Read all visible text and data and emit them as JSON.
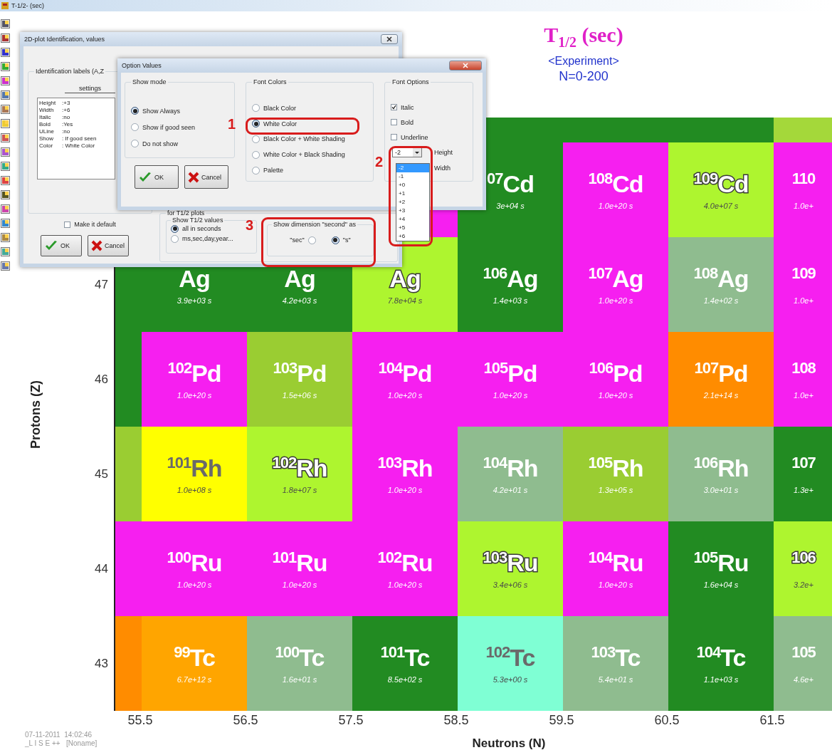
{
  "window": {
    "title": "T-1/2- (sec)"
  },
  "plot": {
    "title": "T$_{1/2}$ (sec)",
    "subtitle": "<Experiment>",
    "range": "N=0-200",
    "y_axis": {
      "label": "Protons (Z)",
      "ticks": [
        "47",
        "46",
        "45",
        "44",
        "43"
      ]
    },
    "x_axis": {
      "label": "Neutrons (N)",
      "ticks": [
        "55.5",
        "56.5",
        "57.5",
        "58.5",
        "59.5",
        "60.5",
        "61.5"
      ]
    },
    "rows": [
      {
        "cells": [
          {
            "kind": "gap"
          },
          {
            "kind": "gap"
          },
          {
            "kind": "gap"
          },
          {
            "kind": "gap"
          },
          {
            "kind": "fill",
            "color": "#228b22"
          },
          {
            "kind": "fill",
            "color": "#228b22"
          },
          {
            "kind": "fill",
            "color": "#228b22"
          },
          {
            "kind": "fill",
            "color": "#a4d83a"
          }
        ]
      },
      {
        "cells": [
          {
            "kind": "gap"
          },
          {
            "kind": "gap"
          },
          {
            "kind": "gap"
          },
          {
            "kind": "fill",
            "color": "#f61ff0"
          },
          {
            "kind": "nuclide",
            "color": "#228b22",
            "mass": "07",
            "symbol": "Cd",
            "value": "3e+04 s"
          },
          {
            "kind": "nuclide",
            "color": "#f61ff0",
            "mass": "108",
            "symbol": "Cd",
            "value": "1.0e+20 s"
          },
          {
            "kind": "nuclide",
            "color": "#aef52f",
            "mass": "109",
            "symbol": "Cd",
            "value": "4.0e+07 s"
          },
          {
            "kind": "nuclide",
            "color": "#f61ff0",
            "mass": "110",
            "value": "1.0e+"
          }
        ]
      },
      {
        "cells": [
          {
            "kind": "fill",
            "color": "#228b22"
          },
          {
            "kind": "nuclide",
            "color": "#228b22",
            "symbol": "Ag",
            "value": "3.9e+03 s"
          },
          {
            "kind": "nuclide",
            "color": "#228b22",
            "symbol": "Ag",
            "value": "4.2e+03 s"
          },
          {
            "kind": "nuclide",
            "color": "#aef52f",
            "symbol": "Ag",
            "value": "7.8e+04 s"
          },
          {
            "kind": "nuclide",
            "color": "#228b22",
            "mass": "106",
            "symbol": "Ag",
            "value": "1.4e+03 s"
          },
          {
            "kind": "nuclide",
            "color": "#f61ff0",
            "mass": "107",
            "symbol": "Ag",
            "value": "1.0e+20 s"
          },
          {
            "kind": "nuclide",
            "color": "#8fbc8f",
            "mass": "108",
            "symbol": "Ag",
            "value": "1.4e+02 s"
          },
          {
            "kind": "nuclide",
            "color": "#f61ff0",
            "mass": "109",
            "value": "1.0e+"
          }
        ]
      },
      {
        "cells": [
          {
            "kind": "fill",
            "color": "#228b22"
          },
          {
            "kind": "nuclide",
            "color": "#f61ff0",
            "mass": "102",
            "symbol": "Pd",
            "value": "1.0e+20 s"
          },
          {
            "kind": "nuclide",
            "color": "#9acd32",
            "mass": "103",
            "symbol": "Pd",
            "value": "1.5e+06 s"
          },
          {
            "kind": "nuclide",
            "color": "#f61ff0",
            "mass": "104",
            "symbol": "Pd",
            "value": "1.0e+20 s"
          },
          {
            "kind": "nuclide",
            "color": "#f61ff0",
            "mass": "105",
            "symbol": "Pd",
            "value": "1.0e+20 s"
          },
          {
            "kind": "nuclide",
            "color": "#f61ff0",
            "mass": "106",
            "symbol": "Pd",
            "value": "1.0e+20 s"
          },
          {
            "kind": "nuclide",
            "color": "#ff8c00",
            "mass": "107",
            "symbol": "Pd",
            "value": "2.1e+14 s"
          },
          {
            "kind": "nuclide",
            "color": "#f61ff0",
            "mass": "108",
            "value": "1.0e+"
          }
        ]
      },
      {
        "cells": [
          {
            "kind": "fill",
            "color": "#9acd32"
          },
          {
            "kind": "nuclide",
            "color": "#ffff00",
            "mass": "101",
            "symbol": "Rh",
            "value": "1.0e+08 s"
          },
          {
            "kind": "nuclide",
            "color": "#aef52f",
            "mass": "102",
            "symbol": "Rh",
            "value": "1.8e+07 s"
          },
          {
            "kind": "nuclide",
            "color": "#f61ff0",
            "mass": "103",
            "symbol": "Rh",
            "value": "1.0e+20 s"
          },
          {
            "kind": "nuclide",
            "color": "#8fbc8f",
            "mass": "104",
            "symbol": "Rh",
            "value": "4.2e+01 s"
          },
          {
            "kind": "nuclide",
            "color": "#9acd32",
            "mass": "105",
            "symbol": "Rh",
            "value": "1.3e+05 s"
          },
          {
            "kind": "nuclide",
            "color": "#8fbc8f",
            "mass": "106",
            "symbol": "Rh",
            "value": "3.0e+01 s"
          },
          {
            "kind": "nuclide",
            "color": "#228b22",
            "mass": "107",
            "value": "1.3e+"
          }
        ]
      },
      {
        "cells": [
          {
            "kind": "fill",
            "color": "#f61ff0"
          },
          {
            "kind": "nuclide",
            "color": "#f61ff0",
            "mass": "100",
            "symbol": "Ru",
            "value": "1.0e+20 s"
          },
          {
            "kind": "nuclide",
            "color": "#f61ff0",
            "mass": "101",
            "symbol": "Ru",
            "value": "1.0e+20 s"
          },
          {
            "kind": "nuclide",
            "color": "#f61ff0",
            "mass": "102",
            "symbol": "Ru",
            "value": "1.0e+20 s"
          },
          {
            "kind": "nuclide",
            "color": "#aef52f",
            "mass": "103",
            "symbol": "Ru",
            "value": "3.4e+06 s"
          },
          {
            "kind": "nuclide",
            "color": "#f61ff0",
            "mass": "104",
            "symbol": "Ru",
            "value": "1.0e+20 s"
          },
          {
            "kind": "nuclide",
            "color": "#228b22",
            "mass": "105",
            "symbol": "Ru",
            "value": "1.6e+04 s"
          },
          {
            "kind": "nuclide",
            "color": "#aef52f",
            "mass": "106",
            "value": "3.2e+"
          }
        ]
      },
      {
        "cells": [
          {
            "kind": "fill",
            "color": "#ff8c00"
          },
          {
            "kind": "nuclide",
            "color": "#ffa500",
            "mass": "99",
            "symbol": "Tc",
            "value": "6.7e+12 s"
          },
          {
            "kind": "nuclide",
            "color": "#8fbc8f",
            "mass": "100",
            "symbol": "Tc",
            "value": "1.6e+01 s"
          },
          {
            "kind": "nuclide",
            "color": "#228b22",
            "mass": "101",
            "symbol": "Tc",
            "value": "8.5e+02 s"
          },
          {
            "kind": "nuclide",
            "color": "#7fffd4",
            "mass": "102",
            "symbol": "Tc",
            "value": "5.3e+00 s"
          },
          {
            "kind": "nuclide",
            "color": "#8fbc8f",
            "mass": "103",
            "symbol": "Tc",
            "value": "5.4e+01 s"
          },
          {
            "kind": "nuclide",
            "color": "#228b22",
            "mass": "104",
            "symbol": "Tc",
            "value": "1.1e+03 s"
          },
          {
            "kind": "nuclide",
            "color": "#8fbc8f",
            "mass": "105",
            "value": "4.6e+"
          }
        ]
      }
    ]
  },
  "identification_dialog": {
    "title": "2D-plot Identification, values",
    "labels_group": "Identification labels  (A,Z",
    "settings_button": "settings",
    "settings_list": [
      {
        "label": "Height",
        "value": ":+3"
      },
      {
        "label": "Width",
        "value": ":+6"
      },
      {
        "label": "Italic",
        "value": ":no"
      },
      {
        "label": "Bold",
        "value": ":Yes"
      },
      {
        "label": "ULine",
        "value": ":no"
      },
      {
        "label": "Show",
        "value": ": If good seen"
      },
      {
        "label": "Color",
        "value": ": White Color"
      }
    ],
    "make_default": {
      "label": "Make it default",
      "checked": false
    },
    "buttons": [
      "OK",
      "Cancel"
    ],
    "t12_group": {
      "title": "for T1/2 plots",
      "values_group": {
        "title": "Show T1/2 values",
        "options": [
          {
            "label": "all in seconds",
            "selected": true
          },
          {
            "label": "ms,sec,day,year...",
            "selected": false
          }
        ]
      },
      "dimension_group": {
        "title": "Show dimension \"second\" as",
        "options": [
          {
            "label": "\"sec\"",
            "selected": false
          },
          {
            "label": "\"s\"",
            "selected": true
          }
        ]
      }
    }
  },
  "options_dialog": {
    "title": "Option Values",
    "show_mode": {
      "title": "Show mode",
      "options": [
        {
          "label": "Show Always",
          "selected": true
        },
        {
          "label": "Show if good seen",
          "selected": false
        },
        {
          "label": "Do not show",
          "selected": false
        }
      ]
    },
    "buttons": [
      "OK",
      "Cancel"
    ],
    "font_colors": {
      "title": "Font Colors",
      "options": [
        {
          "label": "Black Color",
          "selected": false
        },
        {
          "label": "White Color",
          "selected": true
        },
        {
          "label": "Black Color + White Shading",
          "selected": false
        },
        {
          "label": "White Color + Black Shading",
          "selected": false
        },
        {
          "label": "Palette",
          "selected": false
        }
      ]
    },
    "font_options": {
      "title": "Font Options",
      "checks": [
        {
          "label": "Italic",
          "checked": true
        },
        {
          "label": "Bold",
          "checked": false
        },
        {
          "label": "Underline",
          "checked": false
        }
      ],
      "height": {
        "value": "-2",
        "label": "Height",
        "list": [
          {
            "label": "-2",
            "selected": true
          },
          {
            "label": "-1",
            "selected": false
          },
          {
            "label": "+0",
            "selected": false
          },
          {
            "label": "+1",
            "selected": false
          },
          {
            "label": "+2",
            "selected": false
          },
          {
            "label": "+3",
            "selected": false
          },
          {
            "label": "+4",
            "selected": false
          },
          {
            "label": "+5",
            "selected": false
          },
          {
            "label": "+6",
            "selected": false
          }
        ]
      },
      "width_label": "Width"
    }
  },
  "annotations": [
    "1",
    "2",
    "3"
  ],
  "footer": {
    "timestamp": "07-11-2011  14:02:46",
    "app": "_L I S E ++   [Noname]"
  }
}
